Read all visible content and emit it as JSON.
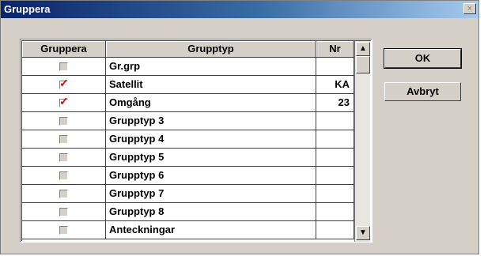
{
  "window": {
    "title": "Gruppera",
    "close_label": "×"
  },
  "table": {
    "headers": [
      "Gruppera",
      "Grupptyp",
      "Nr"
    ],
    "rows": [
      {
        "checked": false,
        "grupptyp": "Gr.grp",
        "nr": ""
      },
      {
        "checked": true,
        "grupptyp": "Satellit",
        "nr": "KA"
      },
      {
        "checked": true,
        "grupptyp": "Omgång",
        "nr": "23"
      },
      {
        "checked": false,
        "grupptyp": "Grupptyp 3",
        "nr": ""
      },
      {
        "checked": false,
        "grupptyp": "Grupptyp 4",
        "nr": ""
      },
      {
        "checked": false,
        "grupptyp": "Grupptyp 5",
        "nr": ""
      },
      {
        "checked": false,
        "grupptyp": "Grupptyp 6",
        "nr": ""
      },
      {
        "checked": false,
        "grupptyp": "Grupptyp 7",
        "nr": ""
      },
      {
        "checked": false,
        "grupptyp": "Grupptyp 8",
        "nr": ""
      },
      {
        "checked": false,
        "grupptyp": "Anteckningar",
        "nr": ""
      }
    ],
    "check_mark": "✓",
    "scroll_up": "▲",
    "scroll_down": "▼"
  },
  "buttons": {
    "ok": "OK",
    "cancel": "Avbryt"
  },
  "colors": {
    "title_bar": "#0a246a",
    "check": "#e00000",
    "face": "#d4d0c8"
  }
}
